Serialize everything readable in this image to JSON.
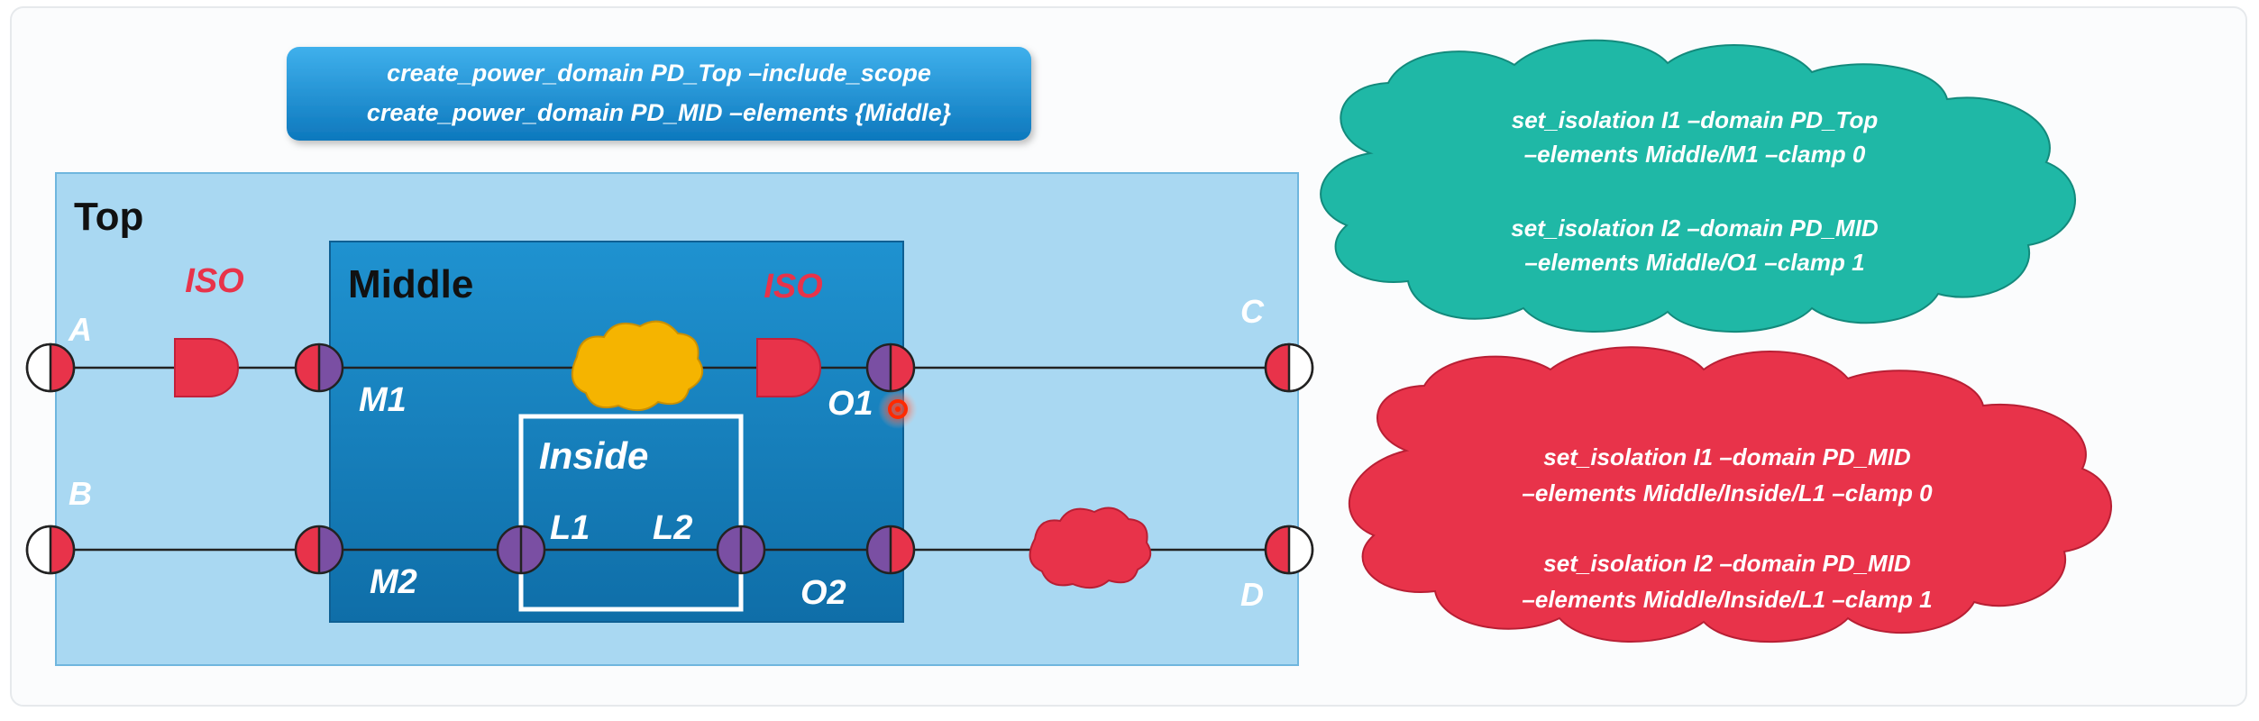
{
  "banner": {
    "line1": "create_power_domain PD_Top –include_scope",
    "line2": "create_power_domain PD_MID –elements {Middle}"
  },
  "blocks": {
    "top": "Top",
    "middle": "Middle",
    "inside": "Inside"
  },
  "iso_labels": [
    "ISO",
    "ISO"
  ],
  "pins": {
    "A": "A",
    "B": "B",
    "C": "C",
    "D": "D",
    "M1": "M1",
    "M2": "M2",
    "O1": "O1",
    "O2": "O2",
    "L1": "L1",
    "L2": "L2"
  },
  "cloud_green": {
    "lines": [
      "set_isolation I1 –domain PD_Top",
      "–elements Middle/M1 –clamp 0",
      "set_isolation I2 –domain PD_MID",
      "–elements Middle/O1 –clamp 1"
    ]
  },
  "cloud_red": {
    "lines": [
      "set_isolation I1 –domain PD_MID",
      "–elements Middle/Inside/L1 –clamp 0",
      "set_isolation I2 –domain PD_MID",
      "–elements Middle/Inside/L1 –clamp 1"
    ]
  },
  "colors": {
    "top_fill": "#a9d8f2",
    "middle_fill": "#1a86c3",
    "banner": "#1a8ed0",
    "iso": "#e8334a",
    "pin_red": "#e8334a",
    "pin_purple": "#7a4fa3",
    "cloud_orange": "#f5b400",
    "cloud_green": "#1fb8a6",
    "cloud_red": "#e8334a",
    "cursor": "#ff2a00"
  }
}
